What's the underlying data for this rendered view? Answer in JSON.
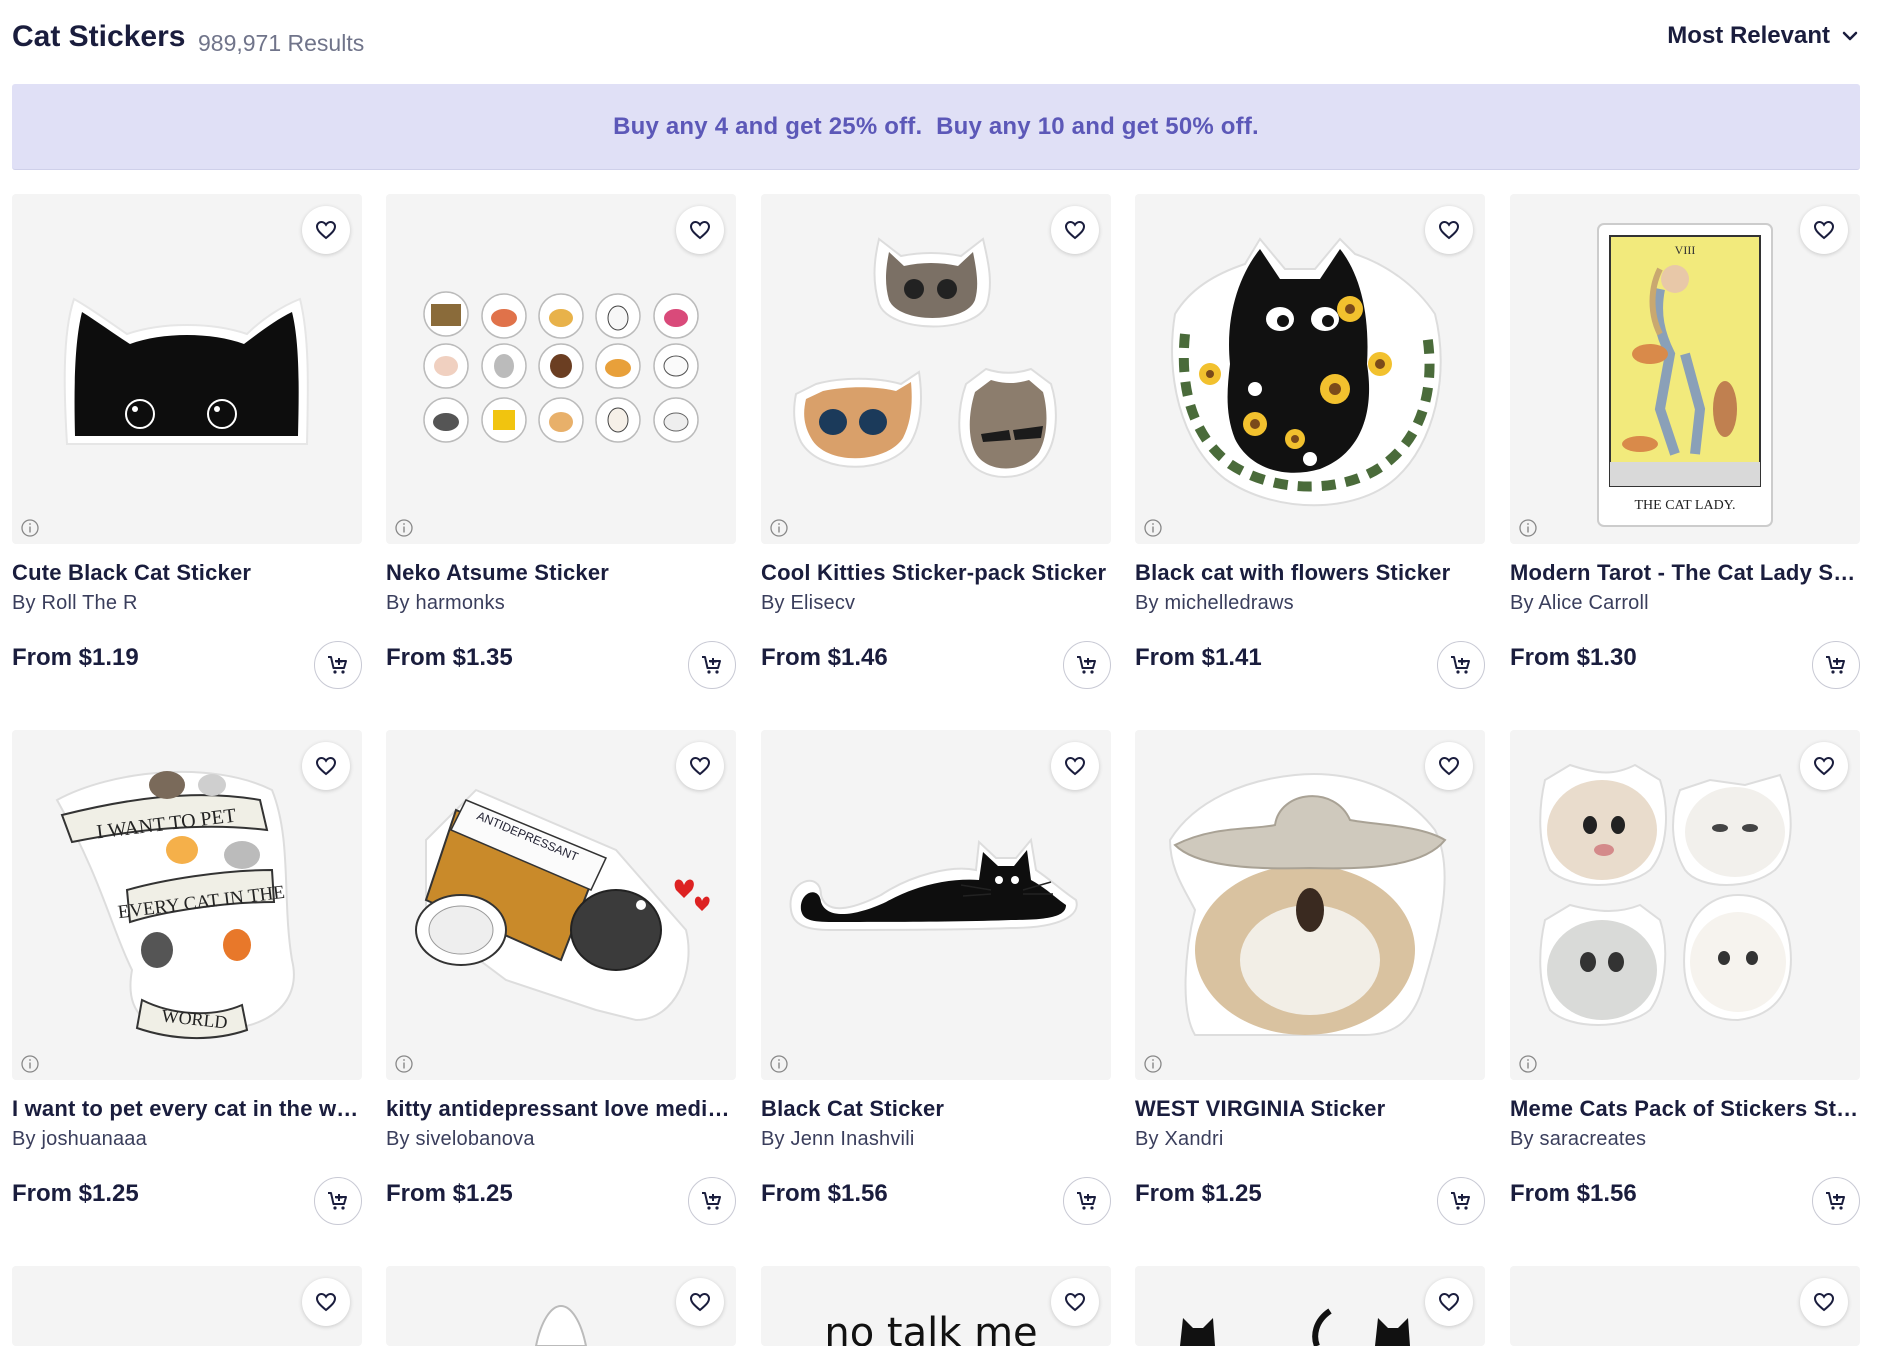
{
  "header": {
    "title": "Cat Stickers",
    "results": "989,971 Results",
    "sort_label": "Most Relevant"
  },
  "promo": {
    "text": "Buy any 4 and get 25% off.  Buy any 10 and get 50% off."
  },
  "colors": {
    "text_primary": "#1a1d3d",
    "promo_bg": "#e0e0f6",
    "promo_text": "#5c58b8",
    "thumb_bg": "#f4f4f4"
  },
  "products": [
    {
      "title": "Cute Black Cat Sticker",
      "by": "By Roll The R",
      "price": "From $1.19"
    },
    {
      "title": "Neko Atsume Sticker",
      "by": "By harmonks",
      "price": "From $1.35"
    },
    {
      "title": "Cool Kitties Sticker-pack Sticker",
      "by": "By Elisecv",
      "price": "From $1.46"
    },
    {
      "title": "Black cat with flowers Sticker",
      "by": "By michelledraws",
      "price": "From $1.41"
    },
    {
      "title": "Modern Tarot - The Cat Lady Sticker",
      "by": "By Alice Carroll",
      "price": "From $1.30"
    },
    {
      "title": "I want to pet every cat in the world Sticker",
      "by": "By joshuanaaa",
      "price": "From $1.25"
    },
    {
      "title": "kitty antidepressant love medicine Sticker",
      "by": "By sivelobanova",
      "price": "From $1.25"
    },
    {
      "title": "Black Cat Sticker",
      "by": "By Jenn Inashvili",
      "price": "From $1.56"
    },
    {
      "title": "WEST VIRGINIA Sticker",
      "by": "By Xandri",
      "price": "From $1.25"
    },
    {
      "title": "Meme Cats Pack of Stickers Sticker",
      "by": "By saracreates",
      "price": "From $1.56"
    }
  ],
  "sticker_text": {
    "tarot_numeral": "VIII",
    "tarot_caption": "THE CAT LADY.",
    "pet_line1": "I WANT TO PET",
    "pet_line2": "EVERY CAT IN THE",
    "pet_line3": "WORLD",
    "pill_label": "ANTIDEPRESSANT",
    "partial_text": "no talk me"
  },
  "icons": {
    "favorite": "heart-icon",
    "cart": "add-to-cart-icon",
    "info": "info-icon",
    "sort": "chevron-down-icon"
  }
}
